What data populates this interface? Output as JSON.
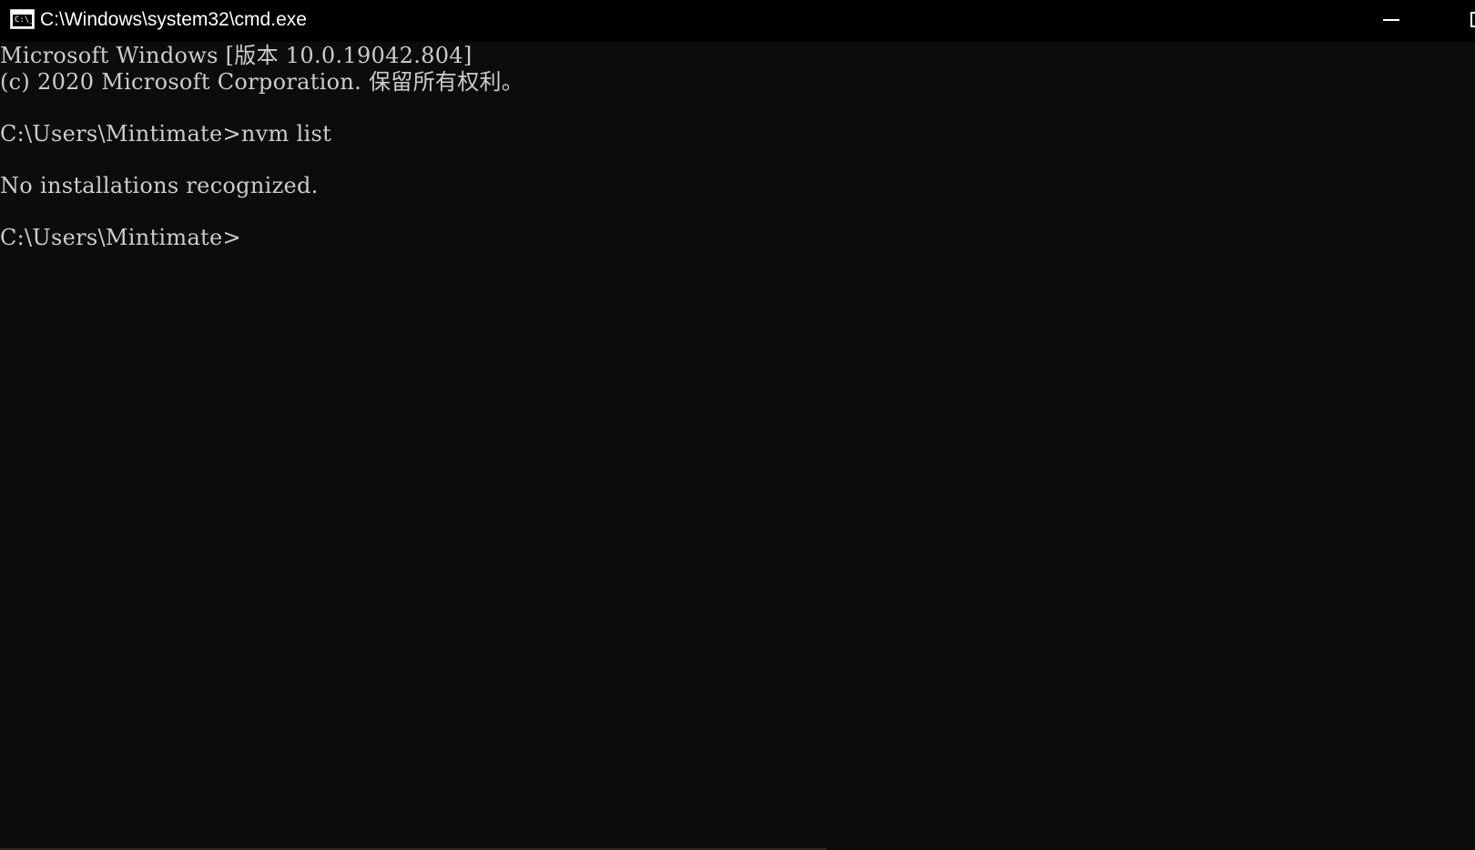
{
  "window": {
    "title": "C:\\Windows\\system32\\cmd.exe",
    "icon": "cmd-icon",
    "icon_text": "C:\\_"
  },
  "console": {
    "lines": [
      "Microsoft Windows [版本 10.0.19042.804]",
      "(c) 2020 Microsoft Corporation. 保留所有权利。",
      "",
      "C:\\Users\\Mintimate>nvm list",
      "",
      "No installations recognized.",
      "",
      "C:\\Users\\Mintimate>"
    ]
  },
  "colors": {
    "titlebar_bg": "#000000",
    "console_bg": "#0c0c0c",
    "console_fg": "#cccccc",
    "title_fg": "#ffffff"
  }
}
